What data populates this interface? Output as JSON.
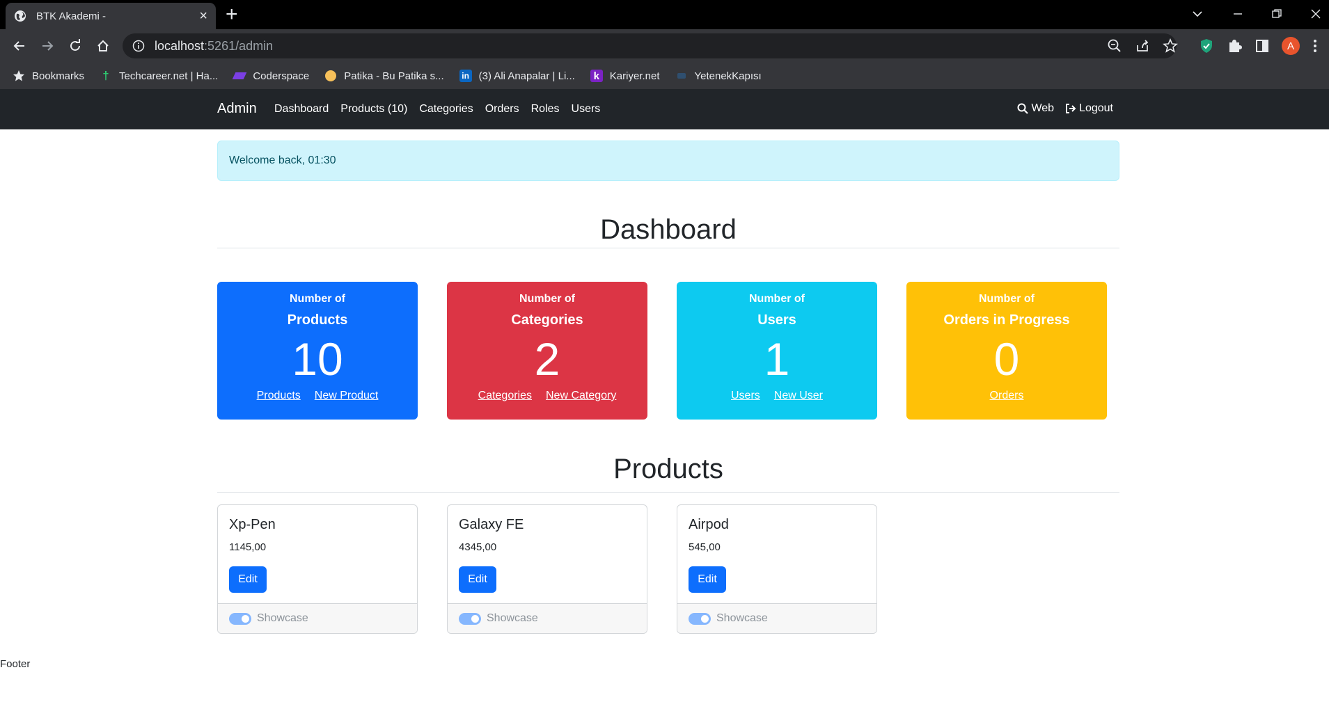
{
  "browser": {
    "tab_title": "BTK Akademi -",
    "url_host": "localhost",
    "url_rest": ":5261/admin",
    "profile_initial": "A",
    "bookmarks": [
      {
        "label": "Bookmarks",
        "icon": "star-icon"
      },
      {
        "label": "Techcareer.net | Ha...",
        "icon": "techcareer-icon"
      },
      {
        "label": "Coderspace",
        "icon": "coderspace-icon"
      },
      {
        "label": "Patika - Bu Patika s...",
        "icon": "patika-icon"
      },
      {
        "label": "(3) Ali Anapalar | Li...",
        "icon": "linkedin-icon"
      },
      {
        "label": "Kariyer.net",
        "icon": "kariyer-icon"
      },
      {
        "label": "YetenekKapısı",
        "icon": "yetenekkapisi-icon"
      }
    ]
  },
  "navbar": {
    "brand": "Admin",
    "links": [
      "Dashboard",
      "Products (10)",
      "Categories",
      "Orders",
      "Roles",
      "Users"
    ],
    "web": "Web",
    "logout": "Logout"
  },
  "alert": {
    "text": "Welcome back, 01:30"
  },
  "dashboard": {
    "title": "Dashboard",
    "cards": [
      {
        "line1": "Number of",
        "line2": "Products",
        "count": "10",
        "links": [
          "Products",
          "New Product"
        ],
        "color": "#0d6efd"
      },
      {
        "line1": "Number of",
        "line2": "Categories",
        "count": "2",
        "links": [
          "Categories",
          "New Category"
        ],
        "color": "#dc3545"
      },
      {
        "line1": "Number of",
        "line2": "Users",
        "count": "1",
        "links": [
          "Users",
          "New User"
        ],
        "color": "#0dcaf0"
      },
      {
        "line1": "Number of",
        "line2": "Orders in Progress",
        "count": "0",
        "links": [
          "Orders"
        ],
        "color": "#ffc107"
      }
    ]
  },
  "products": {
    "title": "Products",
    "items": [
      {
        "name": "Xp-Pen",
        "price": "1145,00",
        "edit": "Edit",
        "showcase": "Showcase"
      },
      {
        "name": "Galaxy FE",
        "price": "4345,00",
        "edit": "Edit",
        "showcase": "Showcase"
      },
      {
        "name": "Airpod",
        "price": "545,00",
        "edit": "Edit",
        "showcase": "Showcase"
      }
    ]
  },
  "footer": {
    "text": "Footer"
  }
}
